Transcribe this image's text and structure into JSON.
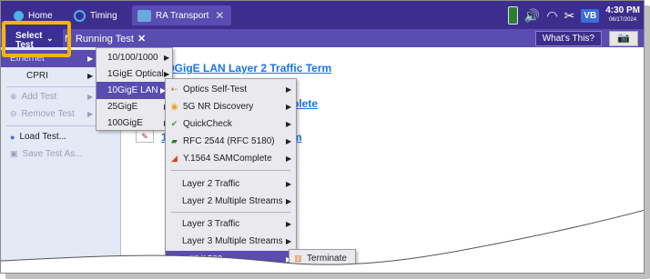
{
  "top_tabs": {
    "home": "Home",
    "timing": "Timing",
    "ra_transport": "RA Transport"
  },
  "status": {
    "time": "4:30 PM",
    "date": "06/17/2024",
    "vb_badge": "VB"
  },
  "subbar": {
    "select_test_line1": "Select",
    "select_test_line2": "Test",
    "running_prefix": "N",
    "running_tab": "Running Test",
    "whats_this": "What's This?"
  },
  "left_panel": {
    "ethernet": "Ethernet",
    "cpri": "CPRI",
    "add_test": "Add Test",
    "remove_test": "Remove Test",
    "load_test": "Load Test...",
    "save_test_as": "Save Test As..."
  },
  "main": {
    "title": "0GigE LAN Layer 2 Traffic Term",
    "link1": "blete",
    "link2": "m",
    "link_num": "1"
  },
  "menu_ethernet": [
    {
      "label": "10/100/1000"
    },
    {
      "label": "1GigE Optical"
    },
    {
      "label": "10GigE LAN"
    },
    {
      "label": "25GigE"
    },
    {
      "label": "100GigE"
    }
  ],
  "menu_10gige": {
    "optics_self_test": "Optics Self-Test",
    "five_g_nr": "5G NR Discovery",
    "quickcheck": "QuickCheck",
    "rfc2544": "RFC 2544 (RFC 5180)",
    "y1564": "Y.1564 SAMComplete",
    "layer2_traffic": "Layer 2 Traffic",
    "layer2_multi": "Layer 2 Multiple Streams",
    "layer3_traffic": "Layer 3 Traffic",
    "layer3_multi": "Layer 3 Multiple Streams",
    "ptp1588": "PTP/1588"
  },
  "menu_ptp": {
    "terminate": "Terminate"
  },
  "colors": {
    "top_bar": "#3d2e8d",
    "accent": "#5a4cb0",
    "highlight_box": "#f5b400",
    "link": "#1a73e8"
  }
}
